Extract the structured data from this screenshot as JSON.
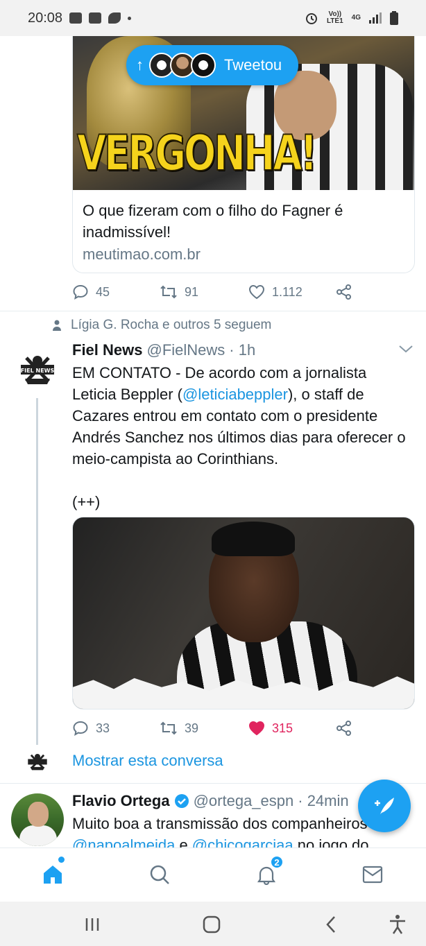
{
  "status_bar": {
    "time": "20:08",
    "net_label_1": "Vo))",
    "net_label_2": "LTE1",
    "net_type": "4G"
  },
  "tweet1": {
    "tweeted_pill_label": "Tweetou",
    "card_image_text": "VERGONHA!",
    "card_description": "O que fizeram com o filho do Fagner é inadmissível!",
    "card_domain": "meutimao.com.br",
    "replies": "45",
    "retweets": "91",
    "likes": "1.112"
  },
  "tweet2": {
    "social_context": "Lígia G. Rocha e outros 5 seguem",
    "name": "Fiel News",
    "handle": "@FielNews",
    "time": "· 1h",
    "body_part1": "EM CONTATO - De acordo com a jornalista Leticia Beppler (",
    "body_mention": "@leticiabeppler",
    "body_part2": "), o staff de Cazares entrou em contato com o presidente Andrés Sanchez nos últimos dias para oferecer o meio-campista ao Corinthians.",
    "body_part3": "(++)",
    "replies": "33",
    "retweets": "39",
    "likes": "315",
    "liked": true,
    "show_conversation": "Mostrar esta conversa"
  },
  "tweet3": {
    "name": "Flavio Ortega",
    "handle": "@ortega_espn",
    "time": "· 24min",
    "line1": "Muito boa a transmissão dos companheiros",
    "line2_mention1": "@napoalmeida",
    "line2_text": " e ",
    "line2_mention2": "@chicogarciaa",
    "line2_tail": " no jogo do"
  },
  "bottom_nav": {
    "notifications_badge": "2"
  },
  "colors": {
    "accent": "#1da1f2",
    "like": "#e0245e",
    "muted": "#657786"
  }
}
